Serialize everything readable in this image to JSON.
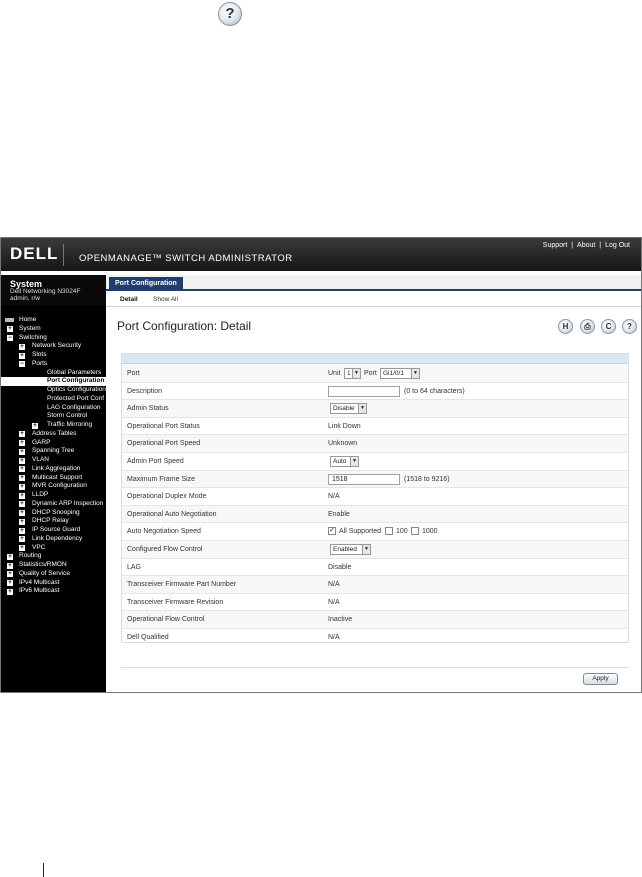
{
  "header": {
    "logo": "DELL",
    "title": "OPENMANAGE™ SWITCH ADMINISTRATOR",
    "links": [
      "Support",
      "About",
      "Log Out"
    ],
    "link_separator": "|"
  },
  "system": {
    "title": "System",
    "model": "Dell Networking N3024F",
    "user": "admin, r/w"
  },
  "nav": [
    {
      "label": "Home",
      "expander": "",
      "level": 0
    },
    {
      "label": "System",
      "expander": "+",
      "level": 0
    },
    {
      "label": "Switching",
      "expander": "−",
      "level": 0
    },
    {
      "label": "Network Security",
      "expander": "+",
      "level": 1
    },
    {
      "label": "Slots",
      "expander": "+",
      "level": 1
    },
    {
      "label": "Ports",
      "expander": "−",
      "level": 1
    },
    {
      "label": "Global Parameters",
      "expander": "",
      "level": 2
    },
    {
      "label": "Port Configuration",
      "expander": "",
      "level": 2,
      "selected": true
    },
    {
      "label": "Optics Configuration",
      "expander": "",
      "level": 2
    },
    {
      "label": "Protected Port Conf",
      "expander": "",
      "level": 2
    },
    {
      "label": "LAG Configuration",
      "expander": "",
      "level": 2
    },
    {
      "label": "Storm Control",
      "expander": "",
      "level": 2
    },
    {
      "label": "Traffic Mirroring",
      "expander": "+",
      "level": 2
    },
    {
      "label": "Address Tables",
      "expander": "+",
      "level": 1
    },
    {
      "label": "GARP",
      "expander": "+",
      "level": 1
    },
    {
      "label": "Spanning Tree",
      "expander": "+",
      "level": 1
    },
    {
      "label": "VLAN",
      "expander": "+",
      "level": 1
    },
    {
      "label": "Link Aggregation",
      "expander": "+",
      "level": 1
    },
    {
      "label": "Multicast Support",
      "expander": "+",
      "level": 1
    },
    {
      "label": "MVR Configuration",
      "expander": "+",
      "level": 1
    },
    {
      "label": "LLDP",
      "expander": "+",
      "level": 1
    },
    {
      "label": "Dynamic ARP Inspection",
      "expander": "+",
      "level": 1
    },
    {
      "label": "DHCP Snooping",
      "expander": "+",
      "level": 1
    },
    {
      "label": "DHCP Relay",
      "expander": "+",
      "level": 1
    },
    {
      "label": "IP Source Guard",
      "expander": "+",
      "level": 1
    },
    {
      "label": "Link Dependency",
      "expander": "+",
      "level": 1
    },
    {
      "label": "VPC",
      "expander": "+",
      "level": 1
    },
    {
      "label": "Routing",
      "expander": "+",
      "level": 0
    },
    {
      "label": "Statistics/RMON",
      "expander": "+",
      "level": 0
    },
    {
      "label": "Quality of Service",
      "expander": "+",
      "level": 0
    },
    {
      "label": "IPv4 Multicast",
      "expander": "+",
      "level": 0
    },
    {
      "label": "IPv6 Multicast",
      "expander": "+",
      "level": 0
    }
  ],
  "tabs": {
    "active": "Port Configuration",
    "sub": [
      "Detail",
      "Show All"
    ]
  },
  "page_title": "Port Configuration: Detail",
  "toolbar_glyphs": {
    "save": "H",
    "print": "⎙",
    "refresh": "C",
    "help": "?"
  },
  "form": {
    "port": {
      "label": "Port",
      "unit_label": "Unit",
      "unit_value": "1",
      "port_label": "Port",
      "port_value": "Gi1/0/1"
    },
    "description": {
      "label": "Description",
      "value": "",
      "hint": "(0 to 64 characters)"
    },
    "admin_status": {
      "label": "Admin Status",
      "value": "Disable"
    },
    "oper_port_status": {
      "label": "Operational Port Status",
      "value": "Link Down"
    },
    "oper_port_speed": {
      "label": "Operational Port Speed",
      "value": "Unknown"
    },
    "admin_port_speed": {
      "label": "Admin Port Speed",
      "value": "Auto"
    },
    "max_frame_size": {
      "label": "Maximum Frame Size",
      "value": "1518",
      "hint": "(1518 to 9216)"
    },
    "oper_duplex": {
      "label": "Operational Duplex Mode",
      "value": "N/A"
    },
    "oper_auto_neg": {
      "label": "Operational Auto Negotiation",
      "value": "Enable"
    },
    "auto_neg_speed": {
      "label": "Auto Negotiation Speed",
      "opt_all": "All Supported",
      "opt_100": "100",
      "opt_1000": "1000",
      "all_checked": "✓"
    },
    "flow_control": {
      "label": "Configured Flow Control",
      "value": "Enabled"
    },
    "lag": {
      "label": "LAG",
      "value": "Disable"
    },
    "fw_part": {
      "label": "Transceiver Firmware Part Number",
      "value": "N/A"
    },
    "fw_rev": {
      "label": "Transceiver Firmware Revision",
      "value": "N/A"
    },
    "oper_flow": {
      "label": "Operational Flow Control",
      "value": "Inactive"
    },
    "dell_qualified": {
      "label": "Dell Qualified",
      "value": "N/A"
    }
  },
  "apply_label": "Apply",
  "help_glyph": "?"
}
